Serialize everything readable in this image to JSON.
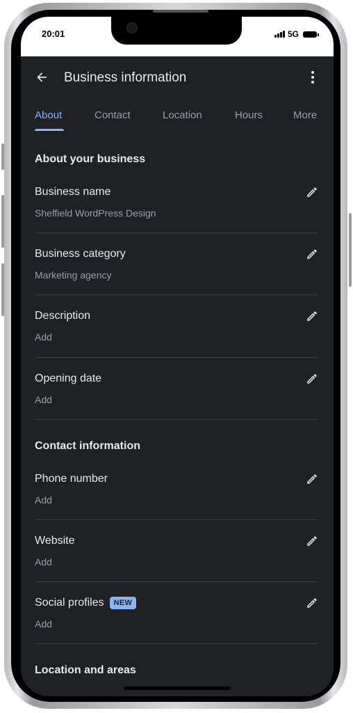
{
  "status_bar": {
    "time": "20:01",
    "network": "5G"
  },
  "app_bar": {
    "title": "Business information"
  },
  "tabs": [
    {
      "label": "About",
      "active": true
    },
    {
      "label": "Contact",
      "active": false
    },
    {
      "label": "Location",
      "active": false
    },
    {
      "label": "Hours",
      "active": false
    },
    {
      "label": "More",
      "active": false
    }
  ],
  "sections": {
    "about": {
      "title": "About your business",
      "rows": [
        {
          "label": "Business name",
          "value": "Sheffield WordPress Design"
        },
        {
          "label": "Business category",
          "value": "Marketing agency"
        },
        {
          "label": "Description",
          "value": "Add"
        },
        {
          "label": "Opening date",
          "value": "Add"
        }
      ]
    },
    "contact": {
      "title": "Contact information",
      "rows": [
        {
          "label": "Phone number",
          "value": "Add"
        },
        {
          "label": "Website",
          "value": "Add"
        },
        {
          "label": "Social profiles",
          "value": "Add",
          "badge": "NEW"
        }
      ]
    },
    "location": {
      "title": "Location and areas"
    }
  },
  "colors": {
    "background": "#202124",
    "accent": "#8ab4f8",
    "text_primary": "#e8eaed",
    "text_secondary": "#9aa0a6",
    "divider": "#3c4043"
  },
  "icons": {
    "back": "arrow-back-icon",
    "more": "more-vert-icon",
    "edit": "pencil-edit-icon"
  }
}
